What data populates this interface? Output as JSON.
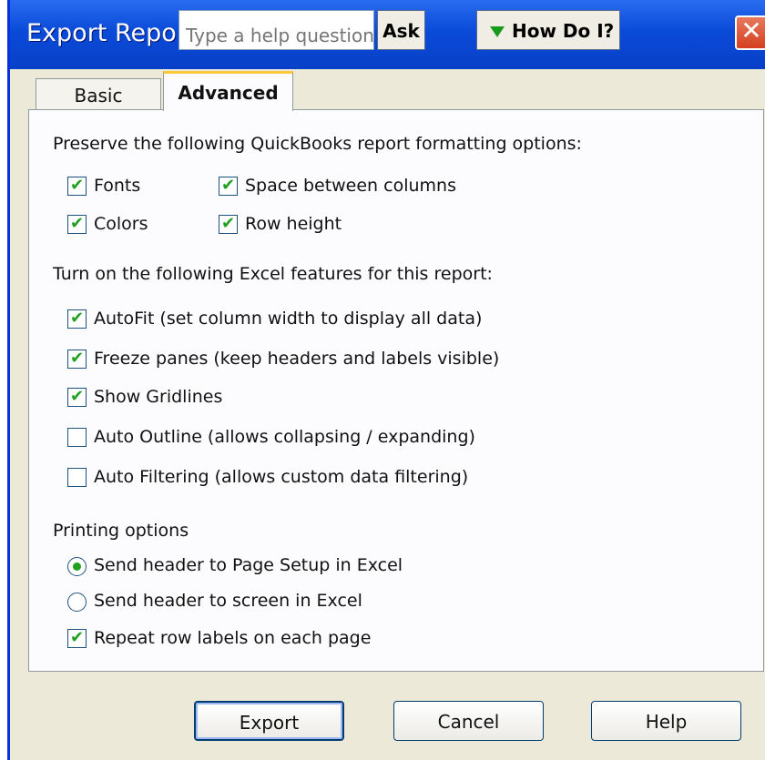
{
  "window": {
    "title": "Export Report",
    "help_placeholder": "Type a help question",
    "ask_label": "Ask",
    "howdoi_label": "How Do I?",
    "close_glyph": "✕",
    "icons": {
      "close": "close-icon",
      "howdoi": "triangle-down-icon"
    }
  },
  "tabs": [
    {
      "label": "Basic",
      "active": false
    },
    {
      "label": "Advanced",
      "active": true
    }
  ],
  "formatting": {
    "heading": "Preserve the following QuickBooks report formatting options:",
    "fonts": {
      "label": "Fonts",
      "checked": true
    },
    "colors": {
      "label": "Colors",
      "checked": true
    },
    "space_between_columns": {
      "label": "Space between columns",
      "checked": true
    },
    "row_height": {
      "label": "Row height",
      "checked": true
    }
  },
  "excel_features": {
    "heading": "Turn on the following Excel features for this report:",
    "autofit": {
      "label": "AutoFit (set column width to display all data)",
      "checked": true
    },
    "freeze_panes": {
      "label": "Freeze panes (keep headers and labels visible)",
      "checked": true
    },
    "show_gridlines": {
      "label": "Show Gridlines",
      "checked": true
    },
    "auto_outline": {
      "label": "Auto Outline (allows collapsing / expanding)",
      "checked": false
    },
    "auto_filtering": {
      "label": "Auto Filtering (allows custom data filtering)",
      "checked": false
    }
  },
  "printing": {
    "heading": "Printing options",
    "header_page_setup": {
      "label": "Send header to Page Setup in Excel",
      "selected": true
    },
    "header_screen": {
      "label": "Send header to screen in Excel",
      "selected": false
    },
    "repeat_row_labels": {
      "label": "Repeat row labels on each page",
      "checked": true
    }
  },
  "buttons": {
    "export": "Export",
    "cancel": "Cancel",
    "help": "Help"
  },
  "check_glyph": "✔",
  "colors": {
    "title_bar": "#0a4ad8",
    "dialog_bg": "#ece9d8",
    "check_green": "#21a121",
    "close_red": "#d4401e",
    "tab_highlight": "#ffc83c"
  }
}
